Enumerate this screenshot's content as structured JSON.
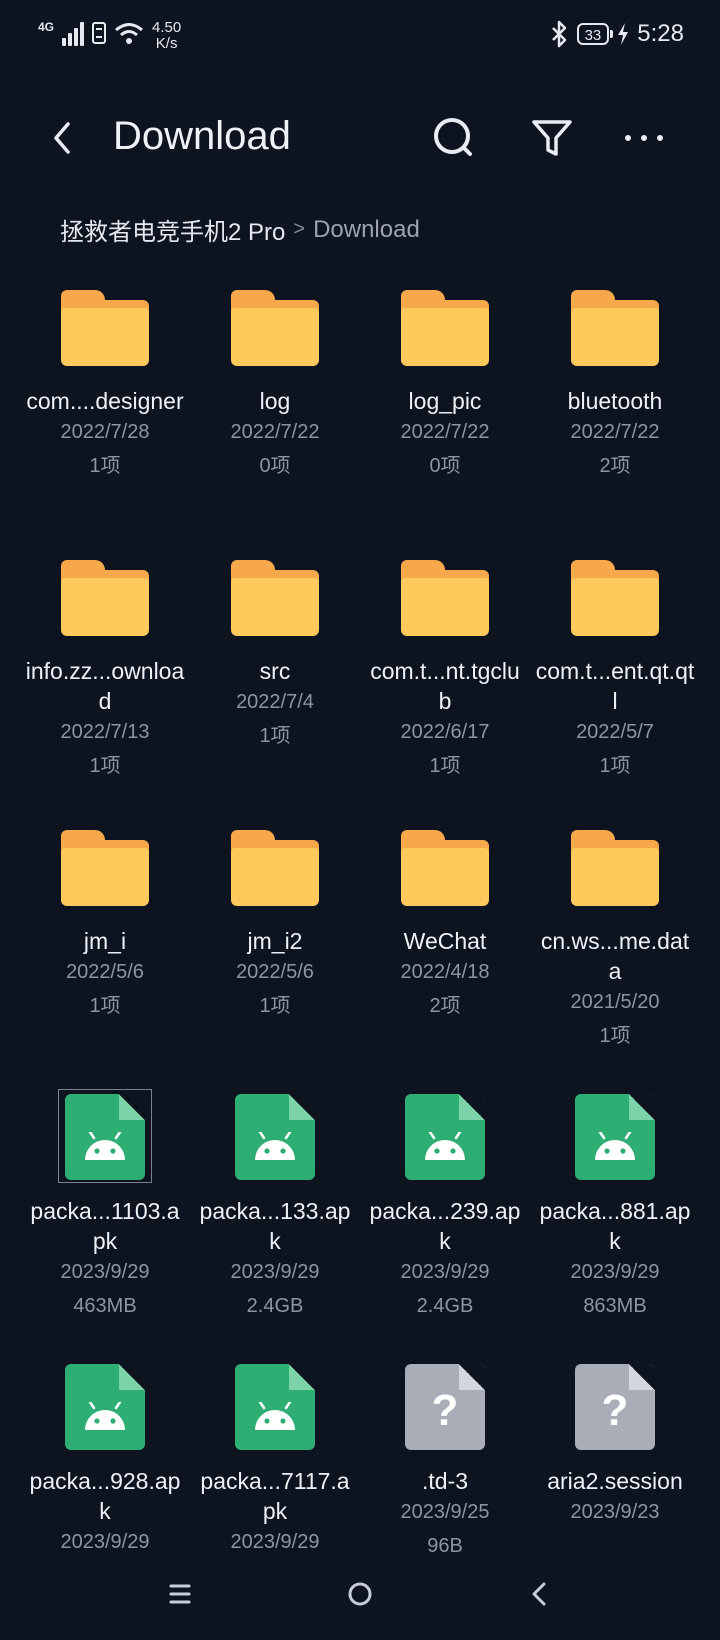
{
  "status_bar": {
    "network": "4G",
    "speed_value": "4.50",
    "speed_unit": "K/s",
    "battery": "33",
    "time": "5:28"
  },
  "header": {
    "title": "Download",
    "icons": [
      "back-arrow-icon",
      "search-icon",
      "filter-icon",
      "more-icon"
    ]
  },
  "breadcrumb": {
    "root": "拯救者电竞手机2 Pro",
    "separator": ">",
    "current": "Download"
  },
  "items": [
    {
      "type": "folder",
      "name": "com....designer",
      "date": "2022/7/28",
      "meta": "1项"
    },
    {
      "type": "folder",
      "name": "log",
      "date": "2022/7/22",
      "meta": "0项"
    },
    {
      "type": "folder",
      "name": "log_pic",
      "date": "2022/7/22",
      "meta": "0项"
    },
    {
      "type": "folder",
      "name": "bluetooth",
      "date": "2022/7/22",
      "meta": "2项"
    },
    {
      "type": "folder",
      "name": "info.zz...ownload",
      "date": "2022/7/13",
      "meta": "1项"
    },
    {
      "type": "folder",
      "name": "src",
      "date": "2022/7/4",
      "meta": "1项"
    },
    {
      "type": "folder",
      "name": "com.t...nt.tgclub",
      "date": "2022/6/17",
      "meta": "1项"
    },
    {
      "type": "folder",
      "name": "com.t...ent.qt.qtl",
      "date": "2022/5/7",
      "meta": "1项"
    },
    {
      "type": "folder",
      "name": "jm_i",
      "date": "2022/5/6",
      "meta": "1项"
    },
    {
      "type": "folder",
      "name": "jm_i2",
      "date": "2022/5/6",
      "meta": "1项"
    },
    {
      "type": "folder",
      "name": "WeChat",
      "date": "2022/4/18",
      "meta": "2项"
    },
    {
      "type": "folder",
      "name": "cn.ws...me.data",
      "date": "2021/5/20",
      "meta": "1项"
    },
    {
      "type": "apk",
      "name": "packa...1103.apk",
      "date": "2023/9/29",
      "meta": "463MB",
      "selected": true
    },
    {
      "type": "apk",
      "name": "packa...133.apk",
      "date": "2023/9/29",
      "meta": "2.4GB"
    },
    {
      "type": "apk",
      "name": "packa...239.apk",
      "date": "2023/9/29",
      "meta": "2.4GB"
    },
    {
      "type": "apk",
      "name": "packa...881.apk",
      "date": "2023/9/29",
      "meta": "863MB"
    },
    {
      "type": "apk",
      "name": "packa...928.apk",
      "date": "2023/9/29",
      "meta": ""
    },
    {
      "type": "apk",
      "name": "packa...7117.apk",
      "date": "2023/9/29",
      "meta": ""
    },
    {
      "type": "unknown",
      "name": ".td-3",
      "date": "2023/9/25",
      "meta": "96B"
    },
    {
      "type": "unknown",
      "name": "aria2.session",
      "date": "2023/9/23",
      "meta": ""
    }
  ],
  "nav_bar": {
    "icons": [
      "menu-icon",
      "home-icon",
      "back-icon"
    ]
  },
  "colors": {
    "background": "#0e1320",
    "folder_front": "#ffc95c",
    "folder_back": "#f7a84a",
    "apk": "#2fae74",
    "unknown_file": "#a9adb8"
  }
}
